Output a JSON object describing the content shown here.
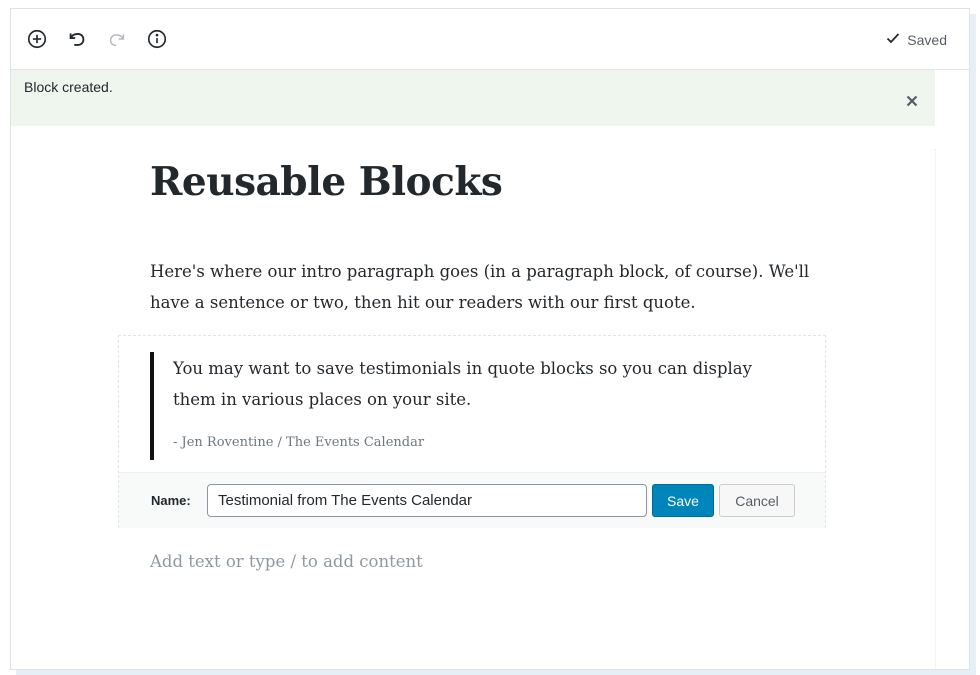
{
  "toolbar": {
    "icons": [
      "add-block-icon",
      "undo-icon",
      "redo-icon",
      "info-icon"
    ],
    "status_label": "Saved"
  },
  "notice": {
    "message": "Block created.",
    "close_icon": "close-icon"
  },
  "post": {
    "title": "Reusable Blocks",
    "intro": "Here's where our intro paragraph goes (in a paragraph block, of course). We'll have a sentence or two, then hit our readers with our first quote."
  },
  "quote": {
    "text": "You may want to save testimonials in quote blocks so you can display them in various places on your site.",
    "citation": "- Jen Roventine / The Events Calendar"
  },
  "reusable_name": {
    "label": "Name:",
    "value": "Testimonial from The Events Calendar",
    "save_label": "Save",
    "cancel_label": "Cancel"
  },
  "editor": {
    "placeholder": "Add text or type / to add content"
  },
  "colors": {
    "notice_bg": "#eef6ee",
    "primary_button": "#0085ba",
    "quote_bar": "#111111"
  }
}
